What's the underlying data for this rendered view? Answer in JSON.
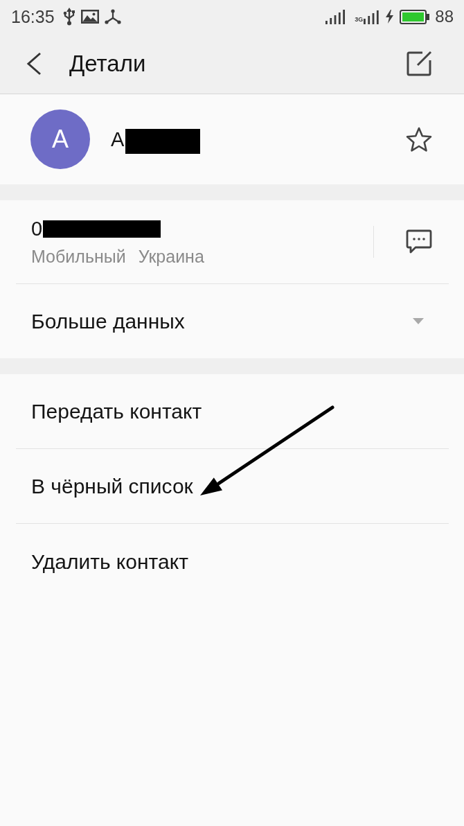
{
  "status_bar": {
    "time": "16:35",
    "network_type": "3G",
    "charging": true,
    "battery": "88"
  },
  "toolbar": {
    "title": "Детали"
  },
  "contact": {
    "avatar_letter": "A",
    "name": "A",
    "name_redacted": true,
    "starred": false
  },
  "phone": {
    "number": "0",
    "number_redacted": true,
    "type": "Мобильный",
    "region": "Украина"
  },
  "more": {
    "label": "Больше данных",
    "expanded": false
  },
  "actions": [
    {
      "label": "Передать контакт",
      "arrow_pointed": false
    },
    {
      "label": "В чёрный список",
      "arrow_pointed": true
    },
    {
      "label": "Удалить контакт",
      "arrow_pointed": false
    }
  ]
}
